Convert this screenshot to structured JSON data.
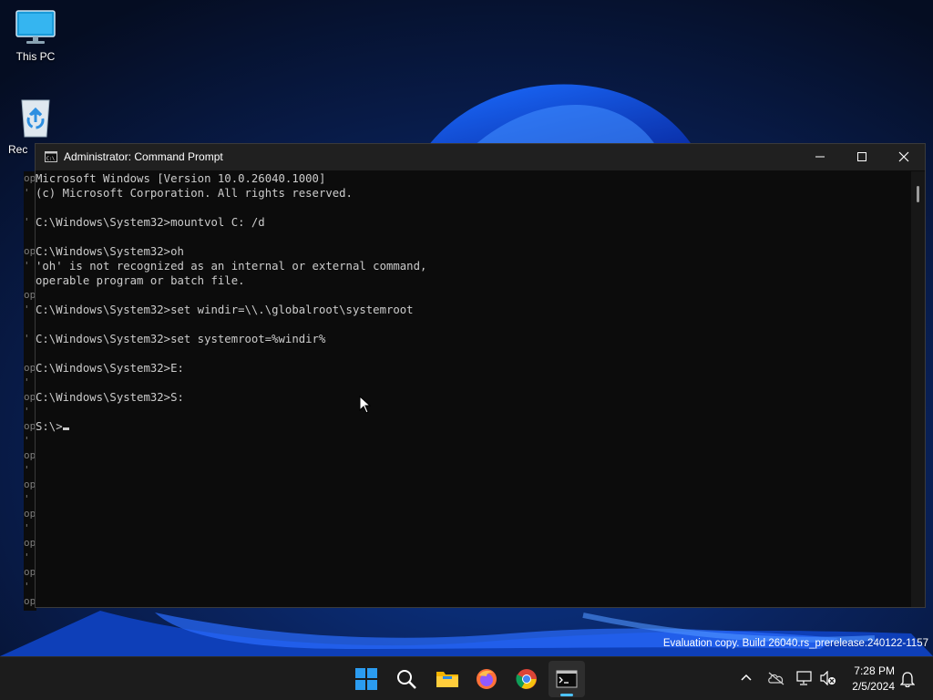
{
  "desktop": {
    "icons": [
      {
        "label": "This PC",
        "icon": "monitor-icon"
      },
      {
        "label": "Recycle Bin",
        "visible_label": "Rec",
        "icon": "recycle-bin-icon"
      }
    ]
  },
  "window": {
    "title": "Administrator: Command Prompt",
    "icon": "cmd-icon",
    "controls": [
      "minimize-icon",
      "maximize-icon",
      "close-icon"
    ]
  },
  "terminal": {
    "lines": [
      "Microsoft Windows [Version 10.0.26040.1000]",
      "(c) Microsoft Corporation. All rights reserved.",
      "",
      "C:\\Windows\\System32>mountvol C: /d",
      "",
      "C:\\Windows\\System32>oh",
      "'oh' is not recognized as an internal or external command,",
      "operable program or batch file.",
      "",
      "C:\\Windows\\System32>set windir=\\\\.\\globalroot\\systemroot",
      "",
      "C:\\Windows\\System32>set systemroot=%windir%",
      "",
      "C:\\Windows\\System32>E:",
      "",
      "C:\\Windows\\System32>S:",
      "",
      "S:\\>"
    ],
    "text_color": "#cccccc",
    "background": "#0c0c0c"
  },
  "background_window": {
    "lines": [
      "op",
      "'",
      "",
      "'",
      "",
      "op",
      "'",
      "",
      "op",
      "'",
      "",
      "'",
      "",
      "op",
      "'",
      "op",
      "'",
      "op",
      "'",
      "op",
      "'",
      "op",
      "'",
      "op",
      "'",
      "op",
      "'",
      "op",
      "'",
      "op"
    ]
  },
  "watermark": "Evaluation copy. Build 26040.rs_prerelease.240122-1157",
  "taskbar": {
    "apps": [
      {
        "name": "Start",
        "icon": "windows-start-icon"
      },
      {
        "name": "Search",
        "icon": "search-icon"
      },
      {
        "name": "File Explorer",
        "icon": "folder-icon"
      },
      {
        "name": "Firefox",
        "icon": "firefox-icon"
      },
      {
        "name": "Chrome",
        "icon": "chrome-icon"
      },
      {
        "name": "Command Prompt",
        "icon": "terminal-icon",
        "active": true
      }
    ],
    "tray_icons": [
      "chevron-up-icon",
      "onedrive-off-icon",
      "network-icon",
      "volume-muted-icon"
    ],
    "time": "7:28 PM",
    "date": "2/5/2024",
    "notification_icon": "bell-icon"
  },
  "colors": {
    "accent": "#0078d4",
    "titlebar": "#202020",
    "taskbar": "#1c1c1c"
  }
}
